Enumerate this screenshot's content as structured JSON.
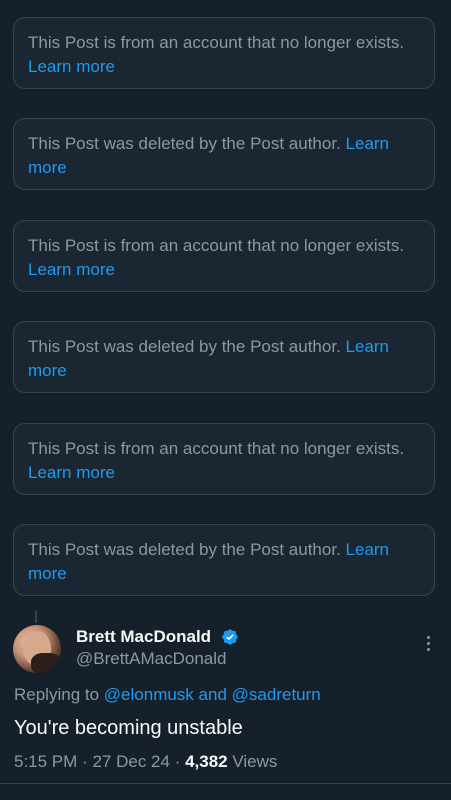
{
  "notices": [
    {
      "text": "This Post is from an account that no longer exists.",
      "link": "Learn more"
    },
    {
      "text": "This Post was deleted by the Post author.",
      "link": "Learn more"
    },
    {
      "text": "This Post is from an account that no longer exists.",
      "link": "Learn more"
    },
    {
      "text": "This Post was deleted by the Post author.",
      "link": "Learn more"
    },
    {
      "text": "This Post is from an account that no longer exists.",
      "link": "Learn more"
    },
    {
      "text": "This Post was deleted by the Post author.",
      "link": "Learn more"
    }
  ],
  "post": {
    "author_name": "Brett MacDonald",
    "author_handle": "@BrettAMacDonald",
    "verified": true,
    "replying_to_label": "Replying to",
    "mention_1": "@elonmusk",
    "mention_and": "and",
    "mention_2": "@sadreturn",
    "text": "You're becoming unstable",
    "time": "5:15 PM",
    "date": "27 Dec 24",
    "separator": "·",
    "views_count": "4,382",
    "views_label": "Views"
  },
  "colors": {
    "background": "#15202b",
    "accent": "#1d9bf0",
    "secondary_text": "#8b98a5",
    "primary_text": "#f7f9f9"
  },
  "icons": {
    "verified": "verified-badge-icon",
    "more": "more-options-icon"
  }
}
